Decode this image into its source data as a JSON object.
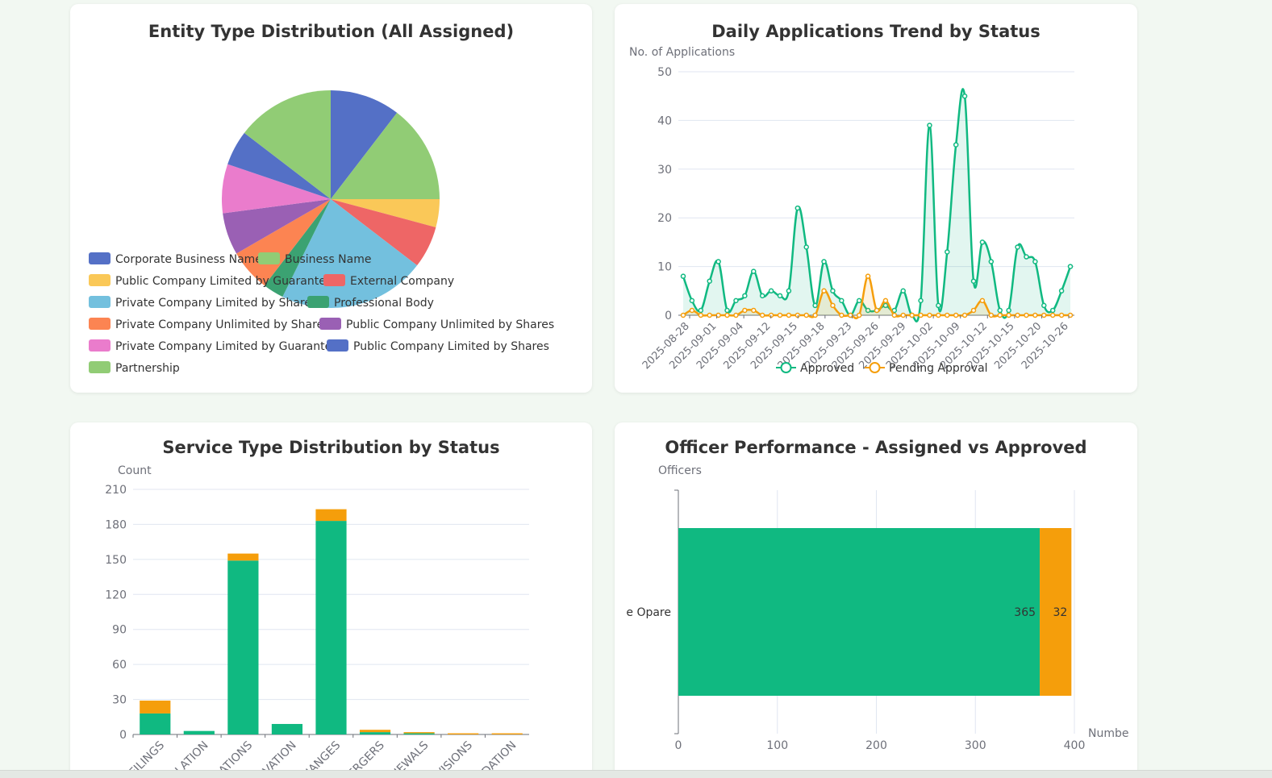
{
  "colors": {
    "approved": "#10b981",
    "pending": "#f59e0b",
    "grid": "#e0e6f1",
    "axis": "#6e7079"
  },
  "cards": {
    "entity": {
      "title": "Entity Type Distribution (All Assigned)"
    },
    "daily": {
      "title": "Daily Applications Trend by Status"
    },
    "service": {
      "title": "Service Type Distribution by Status"
    },
    "officer": {
      "title": "Officer Performance - Assigned vs Approved"
    }
  },
  "chart_data": [
    {
      "type": "pie",
      "title": "Entity Type Distribution (All Assigned)",
      "legend_position": "bottom-left",
      "slices": [
        {
          "label": "Corporate Business Name",
          "value": 10,
          "color": "#5470c6"
        },
        {
          "label": "Business Name",
          "value": 14,
          "color": "#91cc75"
        },
        {
          "label": "Public Company Limited by Guarantee",
          "value": 4,
          "color": "#fac858"
        },
        {
          "label": "External Company",
          "value": 6,
          "color": "#ee6666"
        },
        {
          "label": "Private Company Limited by Shares",
          "value": 21,
          "color": "#73c0de"
        },
        {
          "label": "Professional Body",
          "value": 3,
          "color": "#3ba272"
        },
        {
          "label": "Private Company Unlimited by Shares",
          "value": 6,
          "color": "#fc8452"
        },
        {
          "label": "Public Company Unlimited by Shares",
          "value": 6,
          "color": "#9a60b4"
        },
        {
          "label": "Private Company Limited by Guarantee",
          "value": 7,
          "color": "#ea7ccc"
        },
        {
          "label": "Public Company Limited by Shares",
          "value": 5,
          "color": "#5470c6"
        },
        {
          "label": "Partnership",
          "value": 14,
          "color": "#91cc75"
        }
      ]
    },
    {
      "type": "area",
      "title": "Daily Applications Trend by Status",
      "ylabel": "No. of Applications",
      "ylim": [
        0,
        50
      ],
      "yticks": [
        0,
        10,
        20,
        30,
        40,
        50
      ],
      "grid": true,
      "legend_position": "bottom",
      "x_tick_labels": [
        "2025-08-28",
        "2025-09-01",
        "2025-09-04",
        "2025-09-12",
        "2025-09-15",
        "2025-09-18",
        "2025-09-23",
        "2025-09-26",
        "2025-09-29",
        "2025-10-02",
        "2025-10-09",
        "2025-10-12",
        "2025-10-15",
        "2025-10-20",
        "2025-10-26"
      ],
      "series": [
        {
          "name": "Approved",
          "color": "#10b981",
          "values": [
            8,
            3,
            1,
            7,
            11,
            1,
            3,
            4,
            9,
            4,
            5,
            4,
            5,
            22,
            14,
            2,
            11,
            5,
            3,
            0,
            3,
            1,
            1,
            2,
            1,
            5,
            0,
            3,
            39,
            2,
            13,
            35,
            45,
            7,
            15,
            11,
            1,
            1,
            14,
            12,
            11,
            2,
            1,
            5,
            10
          ]
        },
        {
          "name": "Pending Approval",
          "color": "#f59e0b",
          "values": [
            0,
            1,
            0,
            0,
            0,
            0,
            0,
            1,
            1,
            0,
            0,
            0,
            0,
            0,
            0,
            0,
            5,
            2,
            0,
            0,
            0,
            8,
            1,
            3,
            0,
            0,
            0,
            0,
            0,
            0,
            0,
            0,
            0,
            1,
            3,
            0,
            0,
            0,
            0,
            0,
            0,
            0,
            0,
            0,
            0
          ]
        }
      ]
    },
    {
      "type": "bar",
      "stacked": true,
      "title": "Service Type Distribution by Status",
      "ylabel": "Count",
      "ylim": [
        0,
        210
      ],
      "yticks": [
        0,
        30,
        60,
        90,
        120,
        150,
        180,
        210
      ],
      "grid": true,
      "categories": [
        "FILINGS",
        "LATION",
        "ATIONS",
        "VATION",
        "IANGES",
        "ERGERS",
        "IEWALS",
        "VISIONS",
        "DATION"
      ],
      "series": [
        {
          "name": "Approved",
          "color": "#10b981",
          "values": [
            18,
            3,
            149,
            9,
            183,
            2,
            1,
            0,
            0
          ]
        },
        {
          "name": "Pending Approval",
          "color": "#f59e0b",
          "values": [
            11,
            0,
            6,
            0,
            10,
            2,
            1,
            1,
            1
          ]
        }
      ]
    },
    {
      "type": "bar",
      "orientation": "horizontal",
      "stacked": true,
      "title": "Officer Performance - Assigned vs Approved",
      "ylabel": "Officers",
      "xlabel": "Numbe",
      "xlim": [
        0,
        400
      ],
      "xticks": [
        0,
        100,
        200,
        300,
        400
      ],
      "grid": true,
      "categories": [
        "e Opare"
      ],
      "series": [
        {
          "name": "Approved",
          "color": "#10b981",
          "values": [
            365
          ]
        },
        {
          "name": "Pending Approval",
          "color": "#f59e0b",
          "values": [
            32
          ]
        }
      ]
    }
  ]
}
